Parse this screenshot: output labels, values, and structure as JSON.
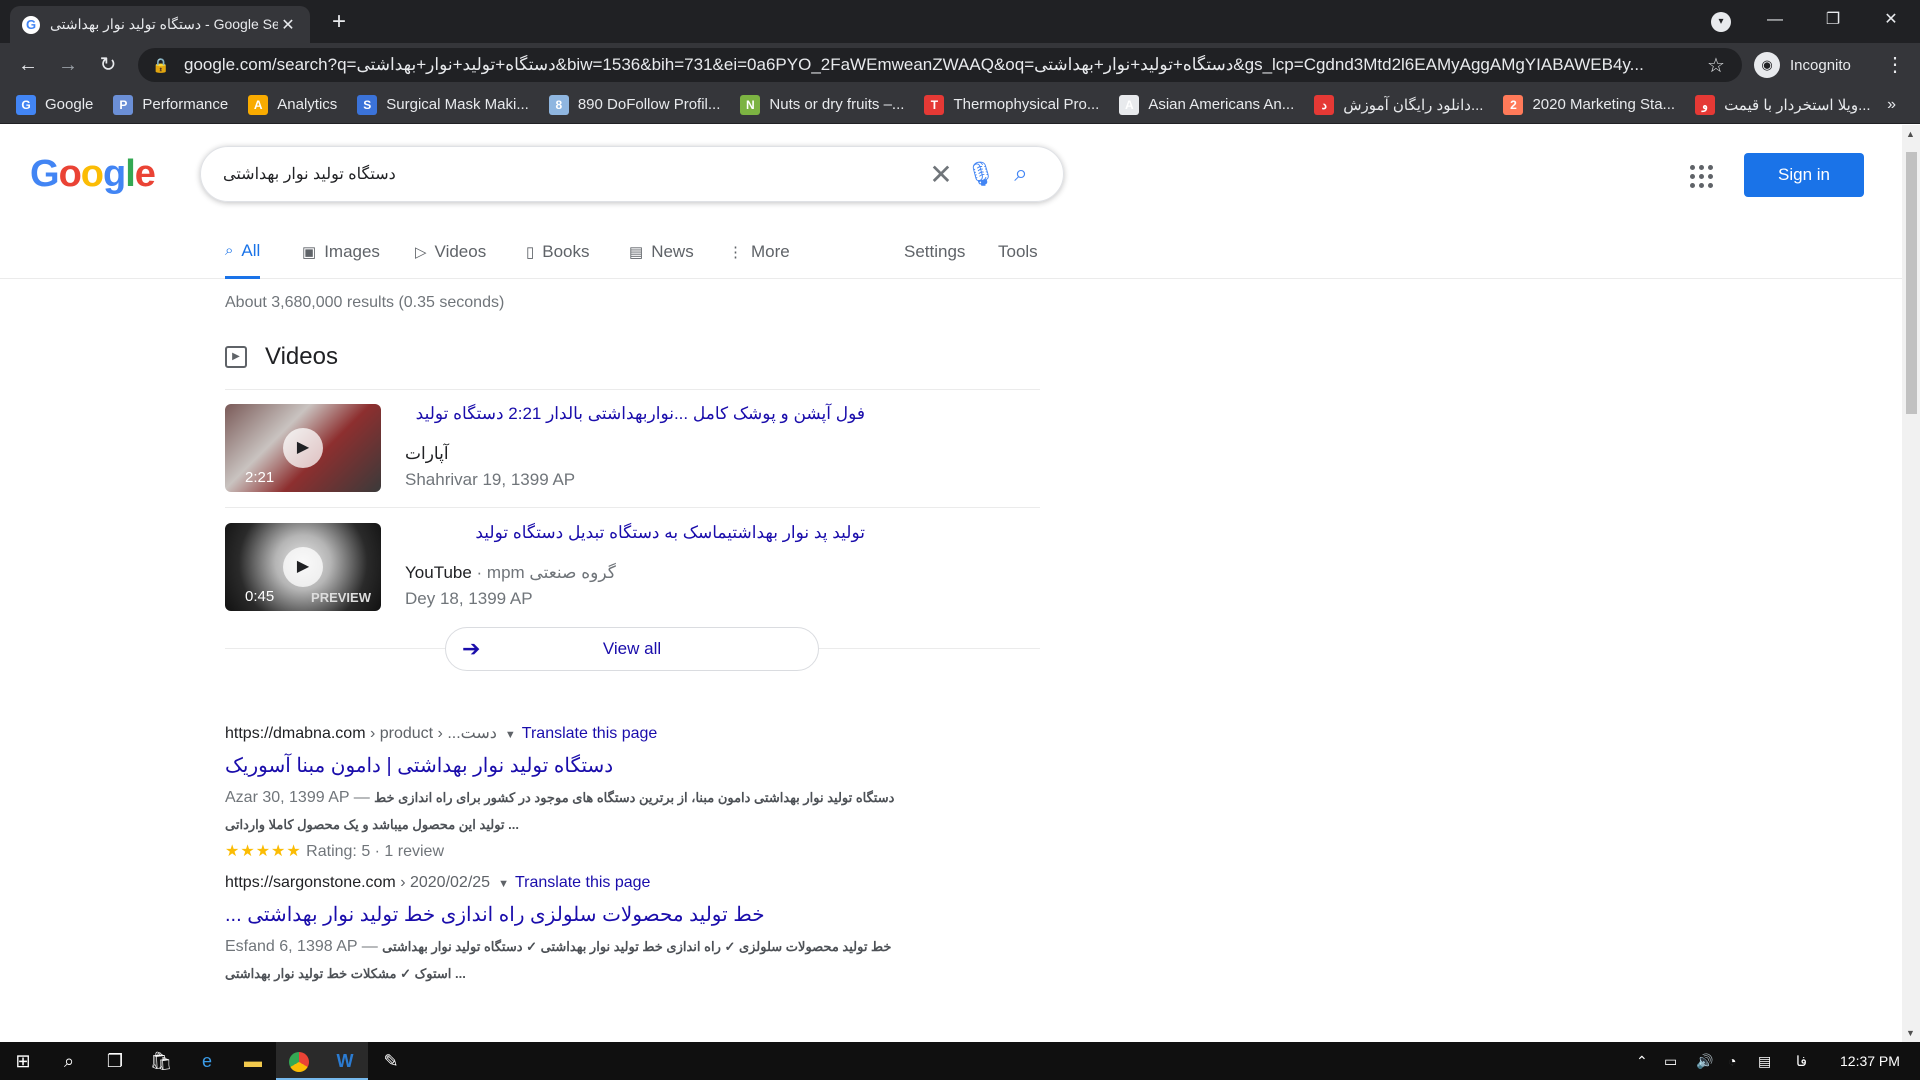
{
  "browser": {
    "tab_title": "دستگاه تولید نوار بهداشتی - Google Search",
    "url": "google.com/search?q=دستگاه+تولید+نوار+بهداشتی&biw=1536&bih=731&ei=0a6PYO_2FaWEmweanZWAAQ&oq=دستگاه+تولید+نوار+بهداشتی&gs_lcp=Cgdnd3Mtd2l6EAMyAggAMgYIABAWEB4y...",
    "incognito_label": "Incognito",
    "bookmarks": [
      {
        "label": "Google",
        "icon": "google-favicon-icon",
        "color": "#4285f4"
      },
      {
        "label": "Performance",
        "icon": "car-icon",
        "color": "#6b8fd6"
      },
      {
        "label": "Analytics",
        "icon": "analytics-icon",
        "color": "#f9ab00"
      },
      {
        "label": "Surgical Mask Maki...",
        "icon": "swirl-icon",
        "color": "#3b73d9"
      },
      {
        "label": "890 DoFollow Profil...",
        "icon": "image-icon",
        "color": "#8fb6e0"
      },
      {
        "label": "Nuts or dry fruits –...",
        "icon": "leaf-icon",
        "color": "#7cb342"
      },
      {
        "label": "Thermophysical Pro...",
        "icon": "red-line-icon",
        "color": "#e53935"
      },
      {
        "label": "Asian Americans An...",
        "icon": "globe-icon",
        "color": "#e8eaed"
      },
      {
        "label": "دانلود رایگان آموزش...",
        "icon": "red-mark-icon",
        "color": "#e53935"
      },
      {
        "label": "2020 Marketing Sta...",
        "icon": "hubspot-icon",
        "color": "#ff7a59"
      },
      {
        "label": "ویلا استخردار با قیمت...",
        "icon": "pin-icon",
        "color": "#e53935"
      }
    ],
    "bookmarks_overflow": "»"
  },
  "google": {
    "logo": [
      "G",
      "o",
      "o",
      "g",
      "l",
      "e"
    ],
    "query": "دستگاه تولید نوار بهداشتی",
    "sign_in": "Sign in",
    "tabs": [
      {
        "label": "All",
        "icon": "search-icon",
        "active": true
      },
      {
        "label": "Images",
        "icon": "image-icon"
      },
      {
        "label": "Videos",
        "icon": "video-icon"
      },
      {
        "label": "Books",
        "icon": "book-icon"
      },
      {
        "label": "News",
        "icon": "news-icon"
      },
      {
        "label": "More",
        "icon": "more-vertical-icon"
      },
      {
        "label": "Settings"
      },
      {
        "label": "Tools"
      }
    ],
    "stats": "About 3,680,000 results (0.35 seconds)",
    "videos_heading": "Videos",
    "videos": [
      {
        "title": "فول آپشن و پوشک کامل ...نواربهداشتی بالدار 2:21 دستگاه تولید",
        "source": "آپارات",
        "source_extra": "",
        "date": "Shahrivar 19, 1399 AP",
        "duration": "2:21",
        "preview": ""
      },
      {
        "title": "تولید پد نوار بهداشتیماسک به دستگاه تبدیل دستگاه تولید",
        "source": "YouTube",
        "source_extra": " · mpm گروه صنعتی",
        "date": "Dey 18, 1399 AP",
        "duration": "0:45",
        "preview": "PREVIEW"
      }
    ],
    "view_all": "View all",
    "results": [
      {
        "domain": "https://dmabna.com",
        "path": " › product › ...دست",
        "translate": "Translate this page",
        "title": "دستگاه تولید نوار بهداشتی | دامون مبنا آسوریک",
        "date": "Azar 30, 1399 AP",
        "dash": " — ",
        "snippet_1": "دستگاه تولید نوار بهداشتی دامون مبنا، از برترین دستگاه های موجود در کشور برای راه اندازی خط",
        "snippet_2": "تولید این محصول میباشد و یک محصول کاملا وارداتی ...",
        "stars": "★★★★★",
        "rating": "Rating: 5 · 1 review"
      },
      {
        "domain": "https://sargonstone.com",
        "path": " › 2020/02/25",
        "translate": "Translate this page",
        "title": "خط تولید محصولات سلولزی راه اندازی خط تولید نوار بهداشتی ...",
        "date": "Esfand 6, 1398 AP",
        "dash": " — ",
        "snippet_1": "خط تولید محصولات سلولزی ✓ راه اندازی خط تولید نوار بهداشتی ✓ دستگاه تولید نوار بهداشتی",
        "snippet_2": "استوک ✓ مشکلات خط تولید نوار بهداشتی ...",
        "stars": "",
        "rating": ""
      }
    ]
  },
  "taskbar": {
    "clock": "12:37 PM",
    "lang": "فا"
  }
}
